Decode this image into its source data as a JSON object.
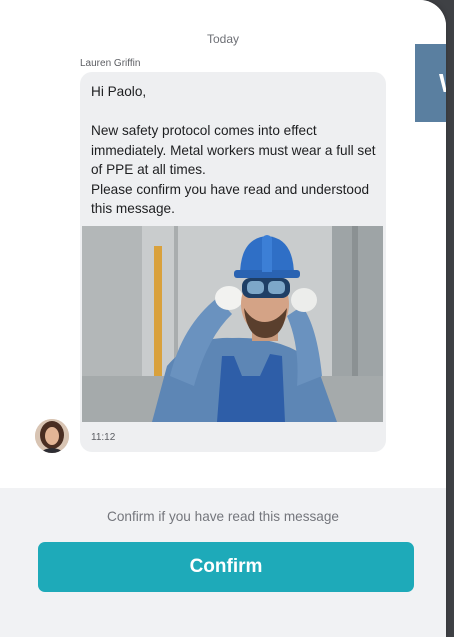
{
  "chat": {
    "date_divider": "Today",
    "message": {
      "sender": "Lauren Griffin",
      "text": "Hi Paolo,\n\nNew safety protocol comes into effect immediately. Metal workers must wear a full set of PPE at all times.\nPlease confirm you have read and understood this message.",
      "time": "11:12",
      "attachment_icon": "worker-in-ppe-photo"
    },
    "avatar_icon": "sender-avatar"
  },
  "side_banner": {
    "letter": "W"
  },
  "confirmation": {
    "hint": "Confirm if you have read this message",
    "button_label": "Confirm"
  },
  "colors": {
    "accent": "#1eaab9",
    "bubble": "#eeeff1",
    "banner": "#5a7fa0"
  }
}
